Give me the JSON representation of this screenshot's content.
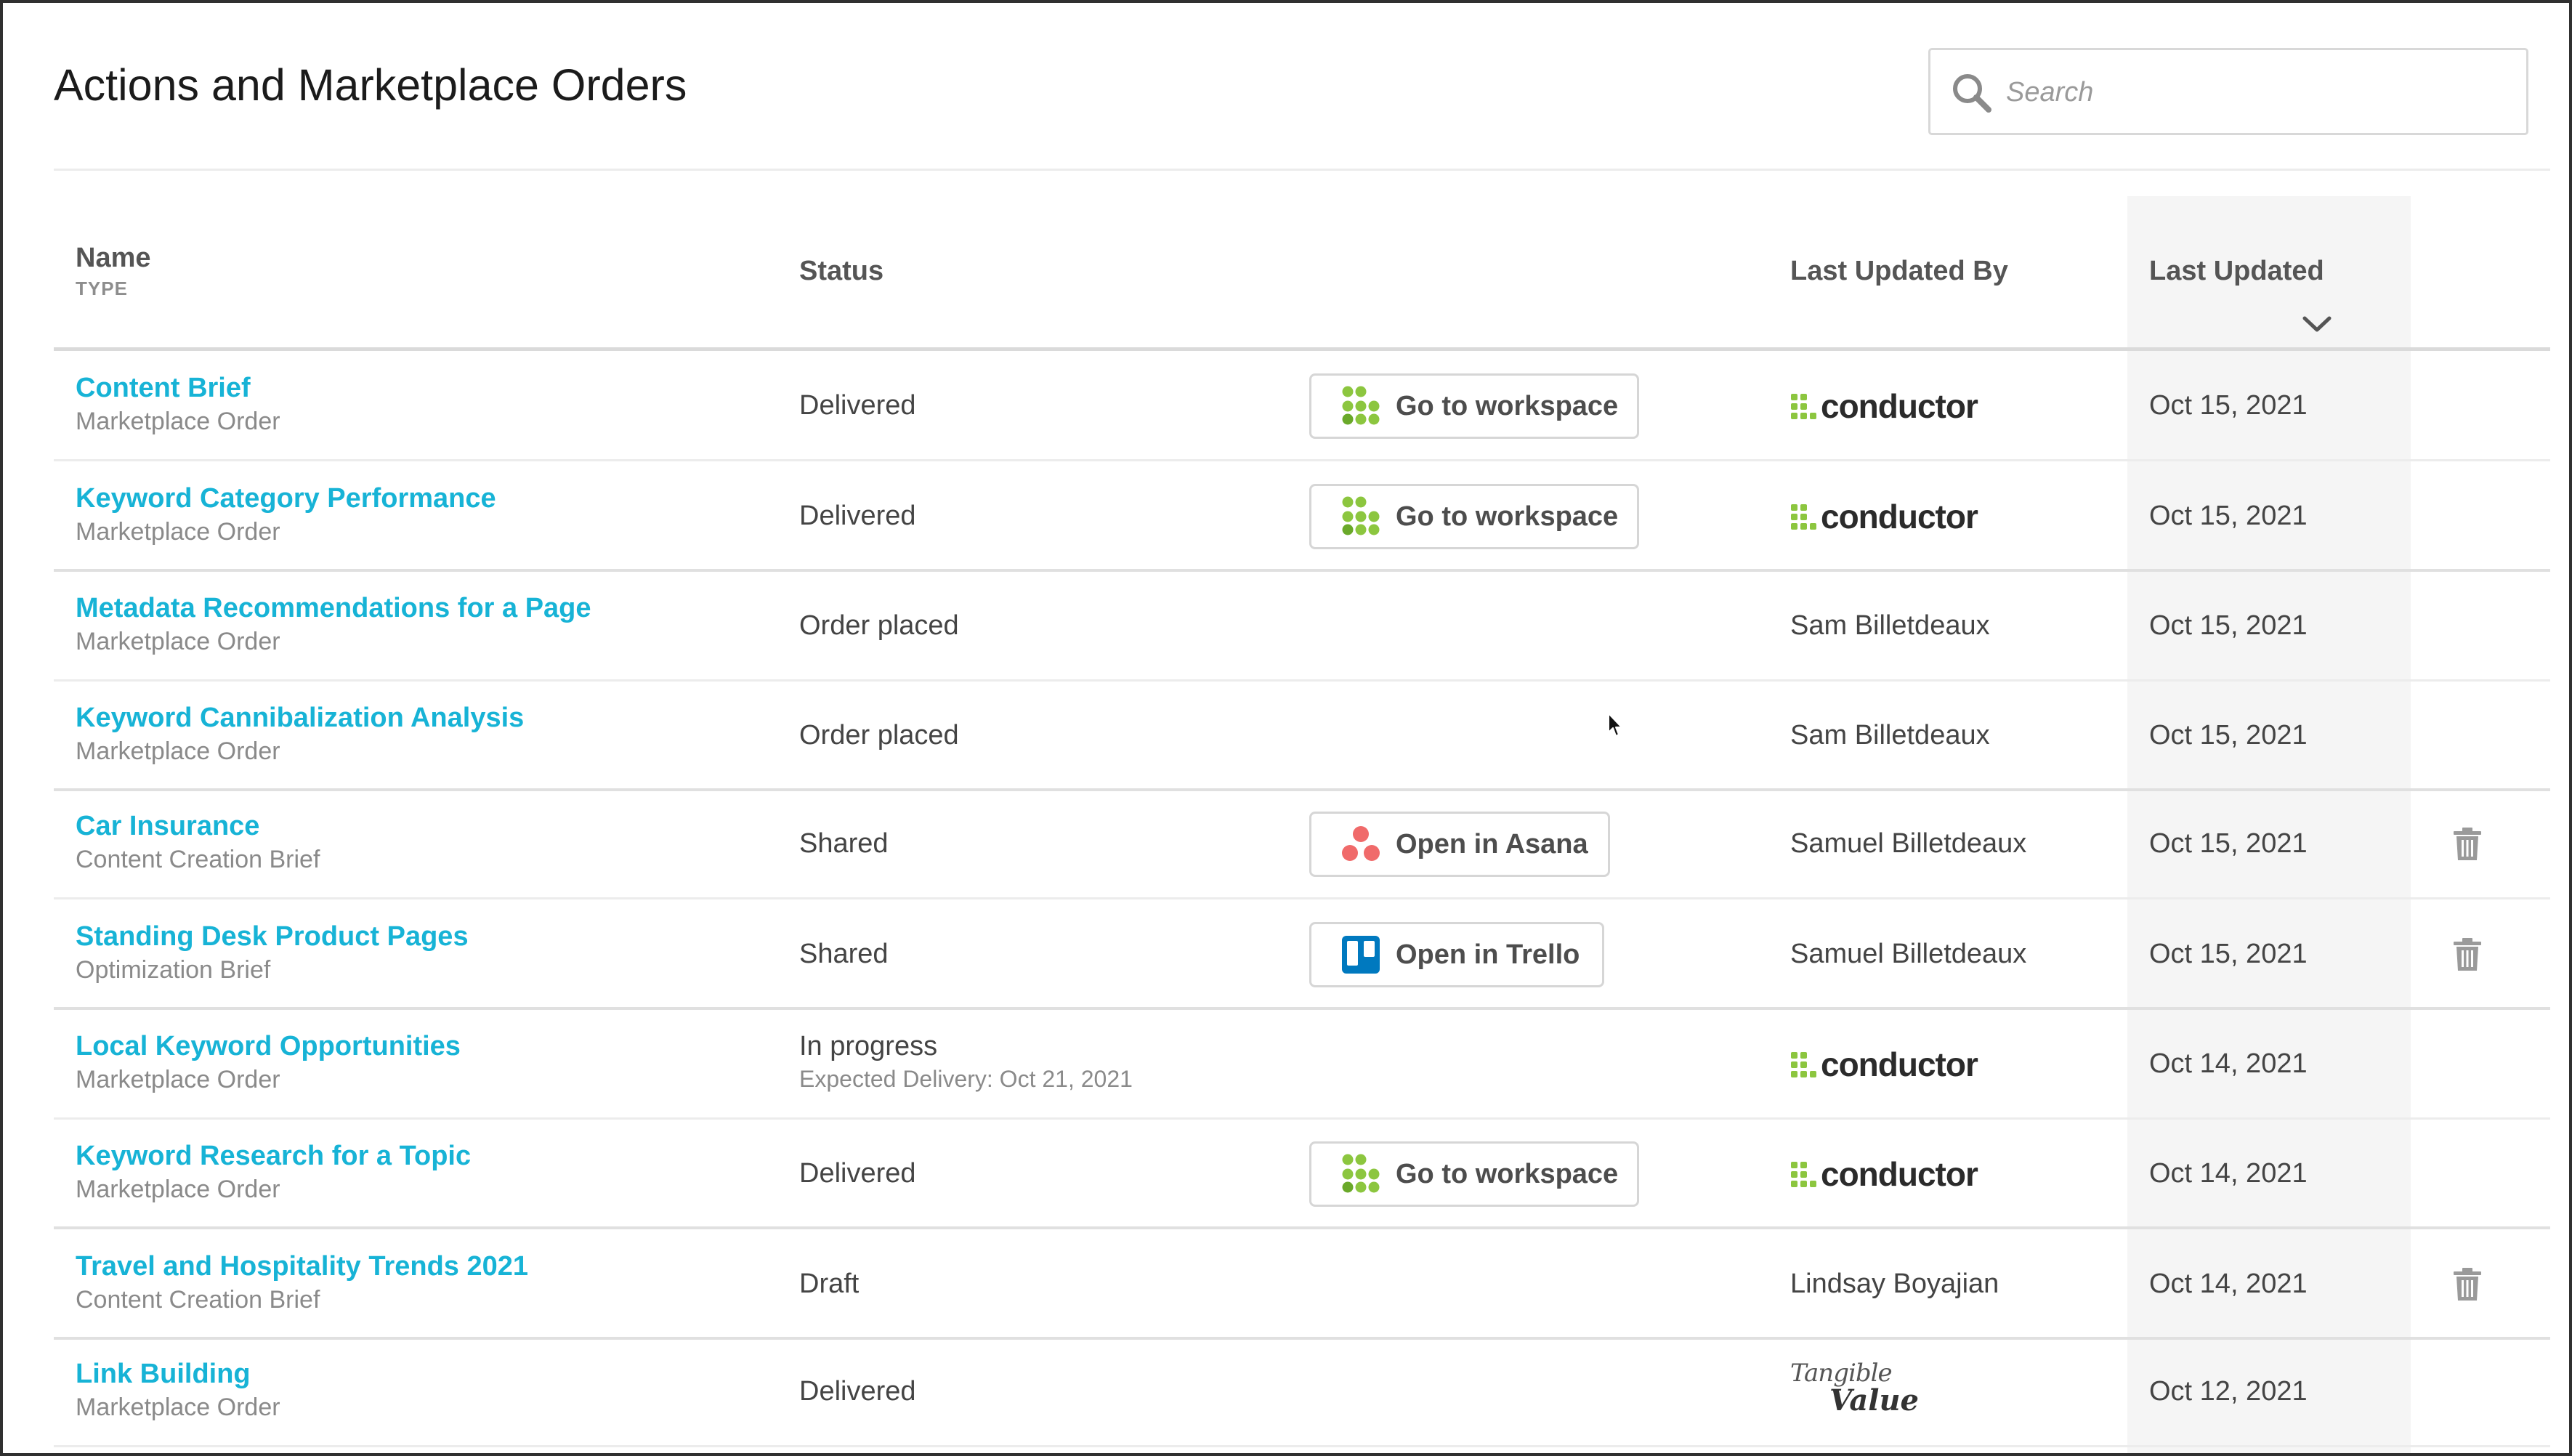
{
  "page": {
    "title": "Actions and Marketplace Orders"
  },
  "search": {
    "placeholder": "Search",
    "icon": "magnifier"
  },
  "table": {
    "headers": {
      "name": "Name",
      "type": "TYPE",
      "status": "Status",
      "last_updated_by": "Last Updated By",
      "last_updated": "Last Updated"
    },
    "sort": {
      "column": "Last Updated",
      "direction": "descending",
      "icon": "chevron-down"
    },
    "rows": [
      {
        "name": "Content Brief",
        "type": "Marketplace Order",
        "status": "Delivered",
        "action": "Go to workspace",
        "action_kind": "workspace",
        "updated_by": "conductor",
        "updated_by_kind": "logo",
        "date": "Oct 15, 2021",
        "deletable": false
      },
      {
        "name": "Keyword Category Performance",
        "type": "Marketplace Order",
        "status": "Delivered",
        "action": "Go to workspace",
        "action_kind": "workspace",
        "updated_by": "conductor",
        "updated_by_kind": "logo",
        "date": "Oct 15, 2021",
        "deletable": false
      },
      {
        "name": "Metadata Recommendations for a Page",
        "type": "Marketplace Order",
        "status": "Order placed",
        "action": "",
        "action_kind": "none",
        "updated_by": "Sam Billetdeaux",
        "updated_by_kind": "text",
        "date": "Oct 15, 2021",
        "deletable": false
      },
      {
        "name": "Keyword Cannibalization Analysis",
        "type": "Marketplace Order",
        "status": "Order placed",
        "action": "",
        "action_kind": "none",
        "updated_by": "Sam Billetdeaux",
        "updated_by_kind": "text",
        "date": "Oct 15, 2021",
        "deletable": false
      },
      {
        "name": "Car Insurance",
        "type": "Content Creation Brief",
        "status": "Shared",
        "action": "Open in Asana",
        "action_kind": "asana",
        "updated_by": "Samuel Billetdeaux",
        "updated_by_kind": "text",
        "date": "Oct 15, 2021",
        "deletable": true
      },
      {
        "name": "Standing Desk Product Pages",
        "type": "Optimization Brief",
        "status": "Shared",
        "action": "Open in Trello",
        "action_kind": "trello",
        "updated_by": "Samuel Billetdeaux",
        "updated_by_kind": "text",
        "date": "Oct 15, 2021",
        "deletable": true
      },
      {
        "name": "Local Keyword Opportunities",
        "type": "Marketplace Order",
        "status": "In progress",
        "status_sub": "Expected Delivery: Oct 21, 2021",
        "action": "",
        "action_kind": "none",
        "updated_by": "conductor",
        "updated_by_kind": "logo",
        "date": "Oct 14, 2021",
        "deletable": false
      },
      {
        "name": "Keyword Research for a Topic",
        "type": "Marketplace Order",
        "status": "Delivered",
        "action": "Go to workspace",
        "action_kind": "workspace",
        "updated_by": "conductor",
        "updated_by_kind": "logo",
        "date": "Oct 14, 2021",
        "deletable": false
      },
      {
        "name": "Travel and Hospitality Trends 2021",
        "type": "Content Creation Brief",
        "status": "Draft",
        "action": "",
        "action_kind": "none",
        "updated_by": "Lindsay Boyajian",
        "updated_by_kind": "text",
        "date": "Oct 14, 2021",
        "deletable": true
      },
      {
        "name": "Link Building",
        "type": "Marketplace Order",
        "status": "Delivered",
        "action": "",
        "action_kind": "none",
        "updated_by": "Tangible Value",
        "updated_by_kind": "tangible-logo",
        "updated_by_parts": [
          "Tangible",
          "Value"
        ],
        "date": "Oct 12, 2021",
        "deletable": false
      }
    ]
  },
  "colors": {
    "link": "#17b3d6",
    "sorted_column_bg": "#f5f5f5",
    "conductor_green": "#8cc63f",
    "asana_coral": "#f06a6a",
    "trello_blue": "#0079bf"
  }
}
